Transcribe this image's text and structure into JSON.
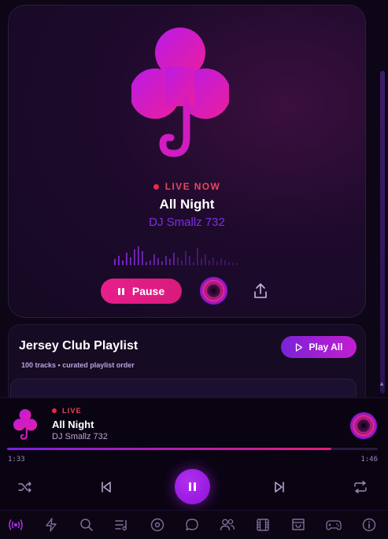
{
  "hero": {
    "live_label": "LIVE NOW",
    "title": "All Night",
    "artist": "DJ Smallz 732",
    "pause_label": "Pause"
  },
  "playlist": {
    "title": "Jersey Club Playlist",
    "subtitle": "100 tracks • curated playlist order",
    "play_all_label": "Play All"
  },
  "mini_player": {
    "live_label": "LIVE",
    "title": "All Night",
    "artist": "DJ Smallz 732",
    "current_time": "1:33",
    "total_time": "1:46",
    "progress": 0.875
  },
  "nav": {
    "items": [
      "radio-icon",
      "bolt-icon",
      "search-icon",
      "playlist-icon",
      "vinyl-icon",
      "chat-icon",
      "users-icon",
      "film-icon",
      "shop-icon",
      "gamepad-icon",
      "info-icon"
    ],
    "active": "radio-icon"
  },
  "colors": {
    "accent_pink": "#e81e8c",
    "accent_purple": "#8b12d8",
    "live_red": "#e8284a"
  }
}
